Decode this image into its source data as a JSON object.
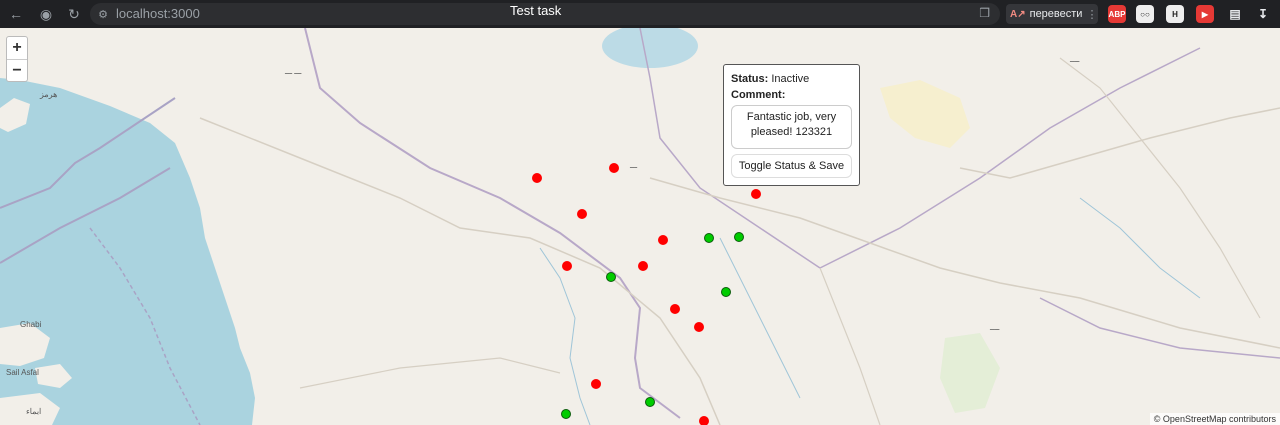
{
  "browser": {
    "url": "localhost:3000",
    "title": "Test task",
    "translate_label": "перевести",
    "extensions": [
      "ABP",
      "glasses",
      "H",
      "youtube",
      "reader",
      "download"
    ]
  },
  "map": {
    "attribution": "© OpenStreetMap contributors",
    "zoom_in": "+",
    "zoom_out": "−",
    "place_labels": [
      "Ghabi",
      "Sail Asfal",
      "ابماء",
      "هرمز"
    ]
  },
  "popup": {
    "status_label": "Status:",
    "status_value": "Inactive",
    "comment_label": "Comment:",
    "comment_value": "Fantastic job, very pleased! 123321",
    "button_label": "Toggle Status & Save"
  },
  "markers": [
    {
      "status": "inactive",
      "color": "#ff0000"
    },
    {
      "status": "inactive",
      "color": "#ff0000"
    },
    {
      "status": "inactive",
      "color": "#ff0000"
    },
    {
      "status": "inactive",
      "color": "#ff0000"
    },
    {
      "status": "inactive",
      "color": "#ff0000"
    },
    {
      "status": "inactive",
      "color": "#ff0000"
    },
    {
      "status": "inactive",
      "color": "#ff0000"
    },
    {
      "status": "inactive",
      "color": "#ff0000"
    },
    {
      "status": "inactive",
      "color": "#ff0000"
    },
    {
      "status": "inactive",
      "color": "#ff0000"
    },
    {
      "status": "inactive",
      "color": "#ff0000"
    },
    {
      "status": "active",
      "color": "#00cc00"
    },
    {
      "status": "active",
      "color": "#00cc00"
    },
    {
      "status": "active",
      "color": "#00cc00"
    },
    {
      "status": "active",
      "color": "#00cc00"
    },
    {
      "status": "active",
      "color": "#00cc00"
    },
    {
      "status": "active",
      "color": "#00cc00"
    }
  ]
}
